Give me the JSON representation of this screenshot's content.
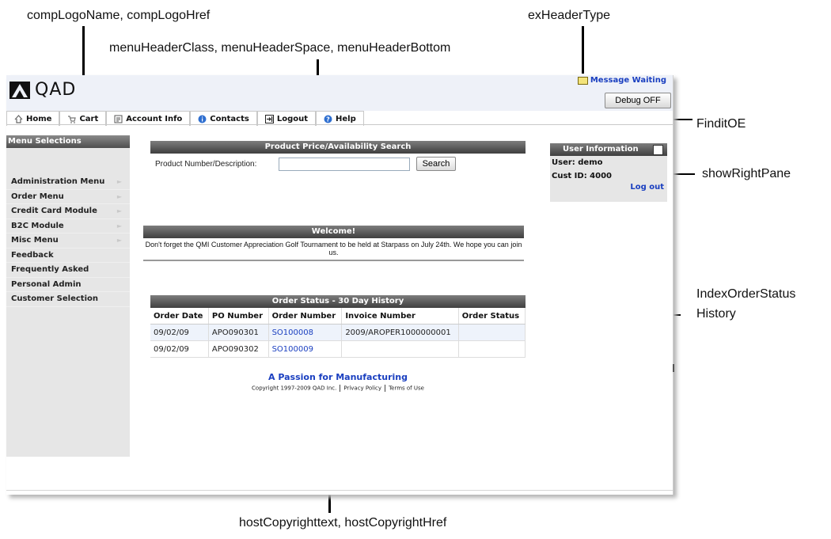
{
  "annotations": {
    "comp_logo": "compLogoName, compLogoHref",
    "ex_header": "exHeaderType",
    "menu_header": "menuHeaderClass, menuHeaderSpace, menuHeaderBottom",
    "findit": "FinditOE",
    "show_right_pane": "showRightPane",
    "index_order_status_line1": "IndexOrderStatus",
    "index_order_status_line2": "History",
    "host_copyright": "hostCopyrighttext, hostCopyrightHref"
  },
  "header": {
    "logo_text": "QAD",
    "message": "Message Waiting",
    "debug_button": "Debug OFF"
  },
  "menu": {
    "tabs": [
      {
        "label": "Home",
        "icon": "home-icon"
      },
      {
        "label": "Cart",
        "icon": "cart-icon"
      },
      {
        "label": "Account Info",
        "icon": "account-icon"
      },
      {
        "label": "Contacts",
        "icon": "info-icon"
      },
      {
        "label": "Logout",
        "icon": "logout-icon"
      },
      {
        "label": "Help",
        "icon": "help-icon"
      }
    ]
  },
  "sidebar": {
    "title": "Menu Selections",
    "items": [
      {
        "label": "Administration Menu",
        "has_arrow": true
      },
      {
        "label": "Order Menu",
        "has_arrow": true
      },
      {
        "label": "Credit Card Module",
        "has_arrow": true
      },
      {
        "label": "B2C Module",
        "has_arrow": true
      },
      {
        "label": "Misc Menu",
        "has_arrow": true
      },
      {
        "label": "Feedback",
        "has_arrow": false
      },
      {
        "label": "Frequently Asked",
        "has_arrow": false
      },
      {
        "label": "Personal Admin",
        "has_arrow": false
      },
      {
        "label": "Customer Selection",
        "has_arrow": false
      }
    ]
  },
  "search": {
    "title": "Product Price/Availability Search",
    "label": "Product Number/Description:",
    "value": "",
    "button": "Search"
  },
  "welcome": {
    "title": "Welcome!",
    "text": "Don't forget the QMI Customer Appreciation Golf Tournament to be held at Starpass on July 24th. We hope you can join us."
  },
  "orders": {
    "title": "Order Status - 30 Day History",
    "columns": [
      "Order Date",
      "PO Number",
      "Order Number",
      "Invoice Number",
      "Order Status"
    ],
    "rows": [
      [
        "09/02/09",
        "APO090301",
        "SO100008",
        "2009/AROPER1000000001",
        ""
      ],
      [
        "09/02/09",
        "APO090302",
        "SO100009",
        "",
        ""
      ]
    ]
  },
  "footer": {
    "tagline": "A Passion for Manufacturing",
    "copyright": "Copyright 1997-2009 QAD Inc.",
    "privacy": "Privacy Policy",
    "terms": "Terms of Use"
  },
  "user_pane": {
    "title": "User Information",
    "user": "User: demo",
    "cust_id": "Cust ID: 4000",
    "logout": "Log out"
  },
  "colors": {
    "link": "#1a3fc0",
    "header_bg": "#eef1f8",
    "bar_dark": "#3f3f3f",
    "sidebar_bg": "#e6e6e6"
  }
}
